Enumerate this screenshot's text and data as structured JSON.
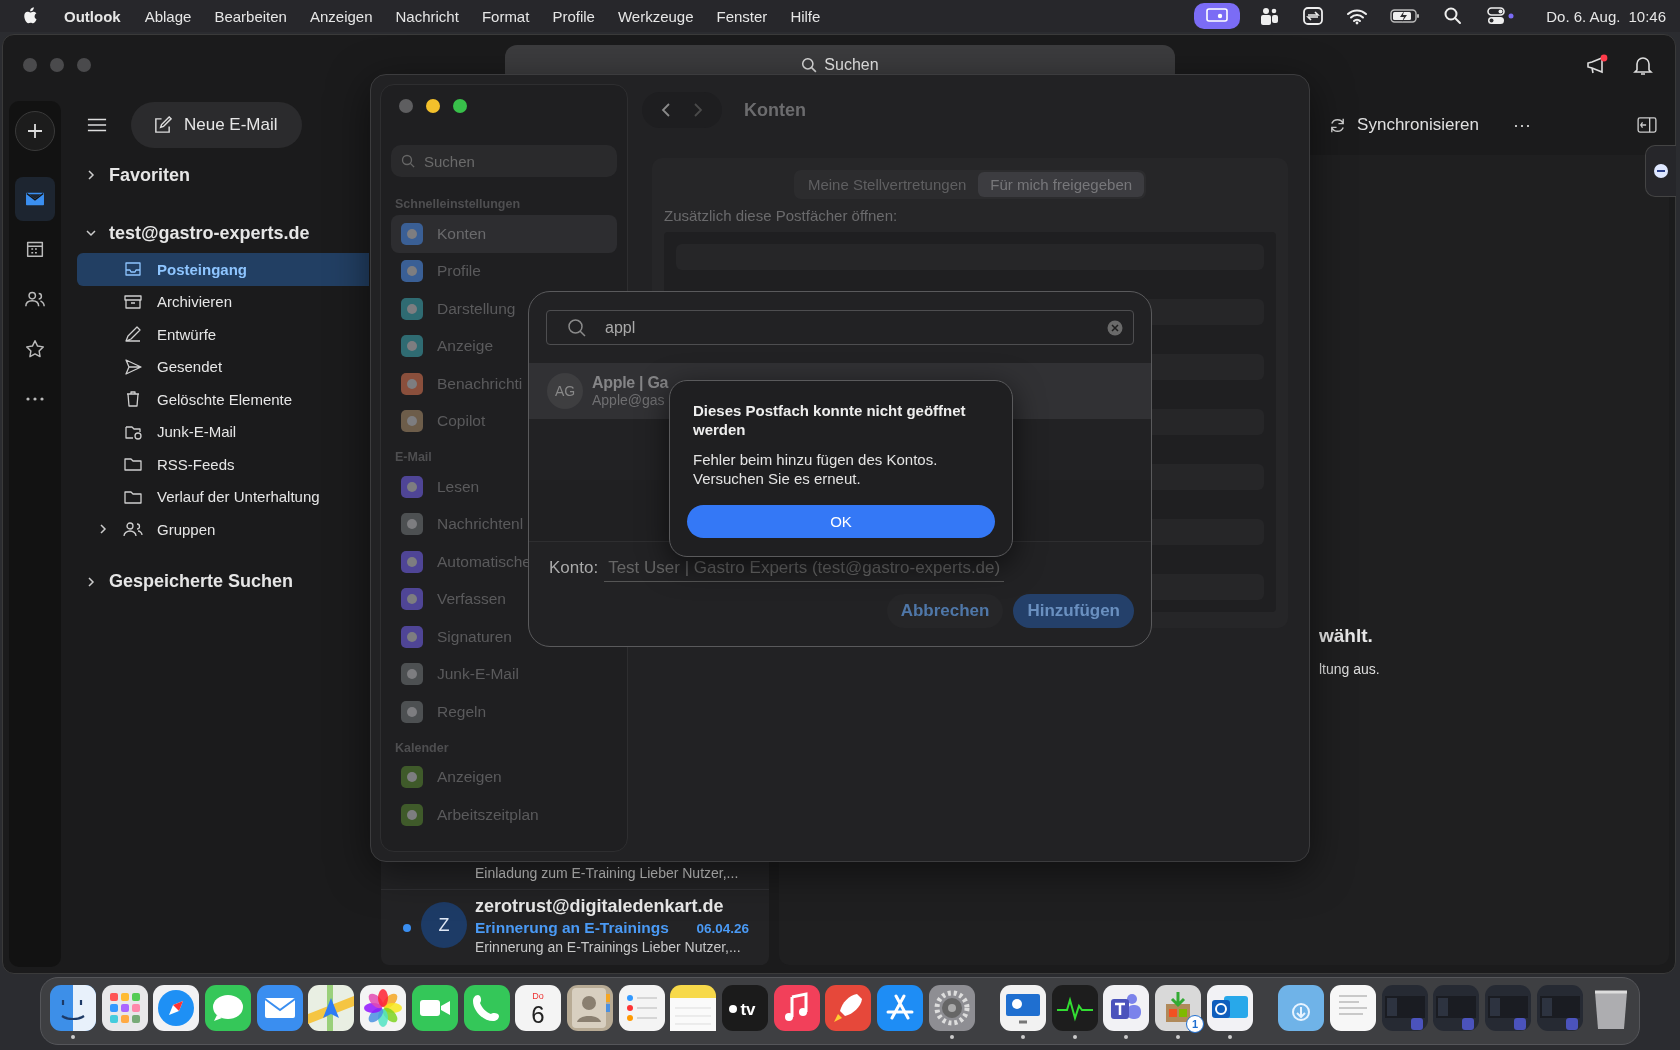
{
  "menu_bar": {
    "app": "Outlook",
    "menus": [
      "Ablage",
      "Bearbeiten",
      "Anzeigen",
      "Nachricht",
      "Format",
      "Profile",
      "Werkzeuge",
      "Fenster",
      "Hilfe"
    ],
    "date": "Do. 6. Aug.",
    "time": "10:46"
  },
  "window": {
    "search_placeholder": "Suchen"
  },
  "rail": [
    {
      "kind": "mail",
      "selected": true
    },
    {
      "kind": "calendar",
      "selected": false
    },
    {
      "kind": "people",
      "selected": false
    },
    {
      "kind": "star",
      "selected": false
    },
    {
      "kind": "more",
      "selected": false
    }
  ],
  "toolbar": {
    "new_mail": "Neue E-Mail",
    "sync": "Synchronisieren",
    "more": "···"
  },
  "folders": {
    "favorites": {
      "label": "Favoriten",
      "expanded": false
    },
    "account": {
      "label": "test@gastro-experts.de",
      "expanded": true,
      "items": [
        {
          "label": "Posteingang",
          "kind": "inbox",
          "selected": true
        },
        {
          "label": "Archivieren",
          "kind": "archive",
          "selected": false
        },
        {
          "label": "Entwürfe",
          "kind": "draft",
          "selected": false
        },
        {
          "label": "Gesendet",
          "kind": "send",
          "selected": false
        },
        {
          "label": "Gelöschte Elemente",
          "kind": "trash",
          "selected": false
        },
        {
          "label": "Junk-E-Mail",
          "kind": "junk",
          "selected": false
        },
        {
          "label": "RSS-Feeds",
          "kind": "folder",
          "selected": false
        },
        {
          "label": "Verlauf der Unterhaltung",
          "kind": "folder",
          "selected": false
        },
        {
          "label": "Gruppen",
          "kind": "people",
          "selected": false,
          "expanded": false
        }
      ]
    },
    "saved": {
      "label": "Gespeicherte Suchen",
      "expanded": false
    }
  },
  "messages": [
    {
      "snippet": "Einladung zum E-Training Lieber Nutzer,..."
    },
    {
      "sender": "zerotrust@digitaledenkart.de",
      "initial": "Z",
      "subject": "Erinnerung an E-Trainings",
      "date": "06.04.26",
      "snippet": "Erinnerung an E-Trainings Lieber Nutzer,...",
      "unread": true
    }
  ],
  "reading_pane": {
    "heading_fragment": "wählt.",
    "text_fragment": "ltung aus."
  },
  "settings": {
    "search_placeholder": "Suchen",
    "title": "Konten",
    "sections": [
      {
        "heading": "Schnelleinstellungen",
        "items": [
          {
            "label": "Konten",
            "color": "#3a5f95",
            "selected": true
          },
          {
            "label": "Profile",
            "color": "#3a5f95",
            "selected": false
          },
          {
            "label": "Darstellung",
            "color": "#2f6b72",
            "selected": false
          },
          {
            "label": "Anzeige",
            "color": "#2f6b72",
            "selected": false
          },
          {
            "label": "Benachrichti",
            "color": "#8a4f3c",
            "selected": false
          },
          {
            "label": "Copilot",
            "color": "#6d5d4a",
            "selected": false
          }
        ]
      },
      {
        "heading": "E-Mail",
        "items": [
          {
            "label": "Lesen",
            "color": "#4f4596",
            "selected": false
          },
          {
            "label": "Nachrichtenl",
            "color": "#4d5052",
            "selected": false
          },
          {
            "label": "Automatische",
            "color": "#4f4596",
            "selected": false
          },
          {
            "label": "Verfassen",
            "color": "#4f4596",
            "selected": false
          },
          {
            "label": "Signaturen",
            "color": "#4f4596",
            "selected": false
          },
          {
            "label": "Junk-E-Mail",
            "color": "#4d5052",
            "selected": false
          },
          {
            "label": "Regeln",
            "color": "#4d5052",
            "selected": false
          }
        ]
      },
      {
        "heading": "Kalender",
        "items": [
          {
            "label": "Anzeigen",
            "color": "#3f5a2a",
            "selected": false
          },
          {
            "label": "Arbeitszeitplan",
            "color": "#3f5a2a",
            "selected": false
          }
        ]
      }
    ],
    "tabs": [
      {
        "label": "Meine Stellvertretungen",
        "selected": false
      },
      {
        "label": "Für mich freigegeben",
        "selected": true
      }
    ],
    "list_label": "Zusätzlich diese Postfächer öffnen:"
  },
  "add_sheet": {
    "query": "appl",
    "result": {
      "initials": "AG",
      "name": "Apple | Ga",
      "email": "Apple@gas",
      "selected": true
    },
    "account_label": "Konto:",
    "account_value": "Test User | Gastro Experts (test@gastro-experts.de)",
    "cancel": "Abbrechen",
    "add": "Hinzufügen"
  },
  "alert": {
    "title": "Dieses Postfach konnte nicht geöffnet werden",
    "message": "Fehler beim hinzu fügen des Kontos. Versuchen Sie es erneut.",
    "button": "OK"
  },
  "dock": [
    {
      "kind": "finder",
      "running": true
    },
    {
      "kind": "launchpad",
      "running": false
    },
    {
      "kind": "safari",
      "running": false
    },
    {
      "kind": "messages",
      "running": false
    },
    {
      "kind": "mail",
      "running": false
    },
    {
      "kind": "maps",
      "running": false
    },
    {
      "kind": "photos",
      "running": false
    },
    {
      "kind": "facetime",
      "running": false
    },
    {
      "kind": "phone",
      "running": false
    },
    {
      "kind": "calendar",
      "weekday": "Do",
      "day": "6",
      "running": false
    },
    {
      "kind": "contacts",
      "running": false
    },
    {
      "kind": "reminders",
      "running": false
    },
    {
      "kind": "notes",
      "running": false
    },
    {
      "kind": "tv",
      "label": "tv",
      "running": false
    },
    {
      "kind": "music",
      "running": false
    },
    {
      "kind": "rocket",
      "running": false
    },
    {
      "kind": "appstore",
      "running": false
    },
    {
      "kind": "settings",
      "running": true
    },
    {
      "kind": "divider"
    },
    {
      "kind": "remote",
      "running": true
    },
    {
      "kind": "activity",
      "running": true
    },
    {
      "kind": "teams",
      "running": true
    },
    {
      "kind": "installer",
      "running": true,
      "badge": "1"
    },
    {
      "kind": "outlook",
      "running": true
    },
    {
      "kind": "divider"
    },
    {
      "kind": "downloads",
      "running": false
    },
    {
      "kind": "document",
      "running": false
    },
    {
      "kind": "thumb",
      "running": false
    },
    {
      "kind": "thumb",
      "running": false
    },
    {
      "kind": "thumb",
      "running": false
    },
    {
      "kind": "thumb",
      "running": false
    },
    {
      "kind": "trash",
      "running": false
    }
  ]
}
